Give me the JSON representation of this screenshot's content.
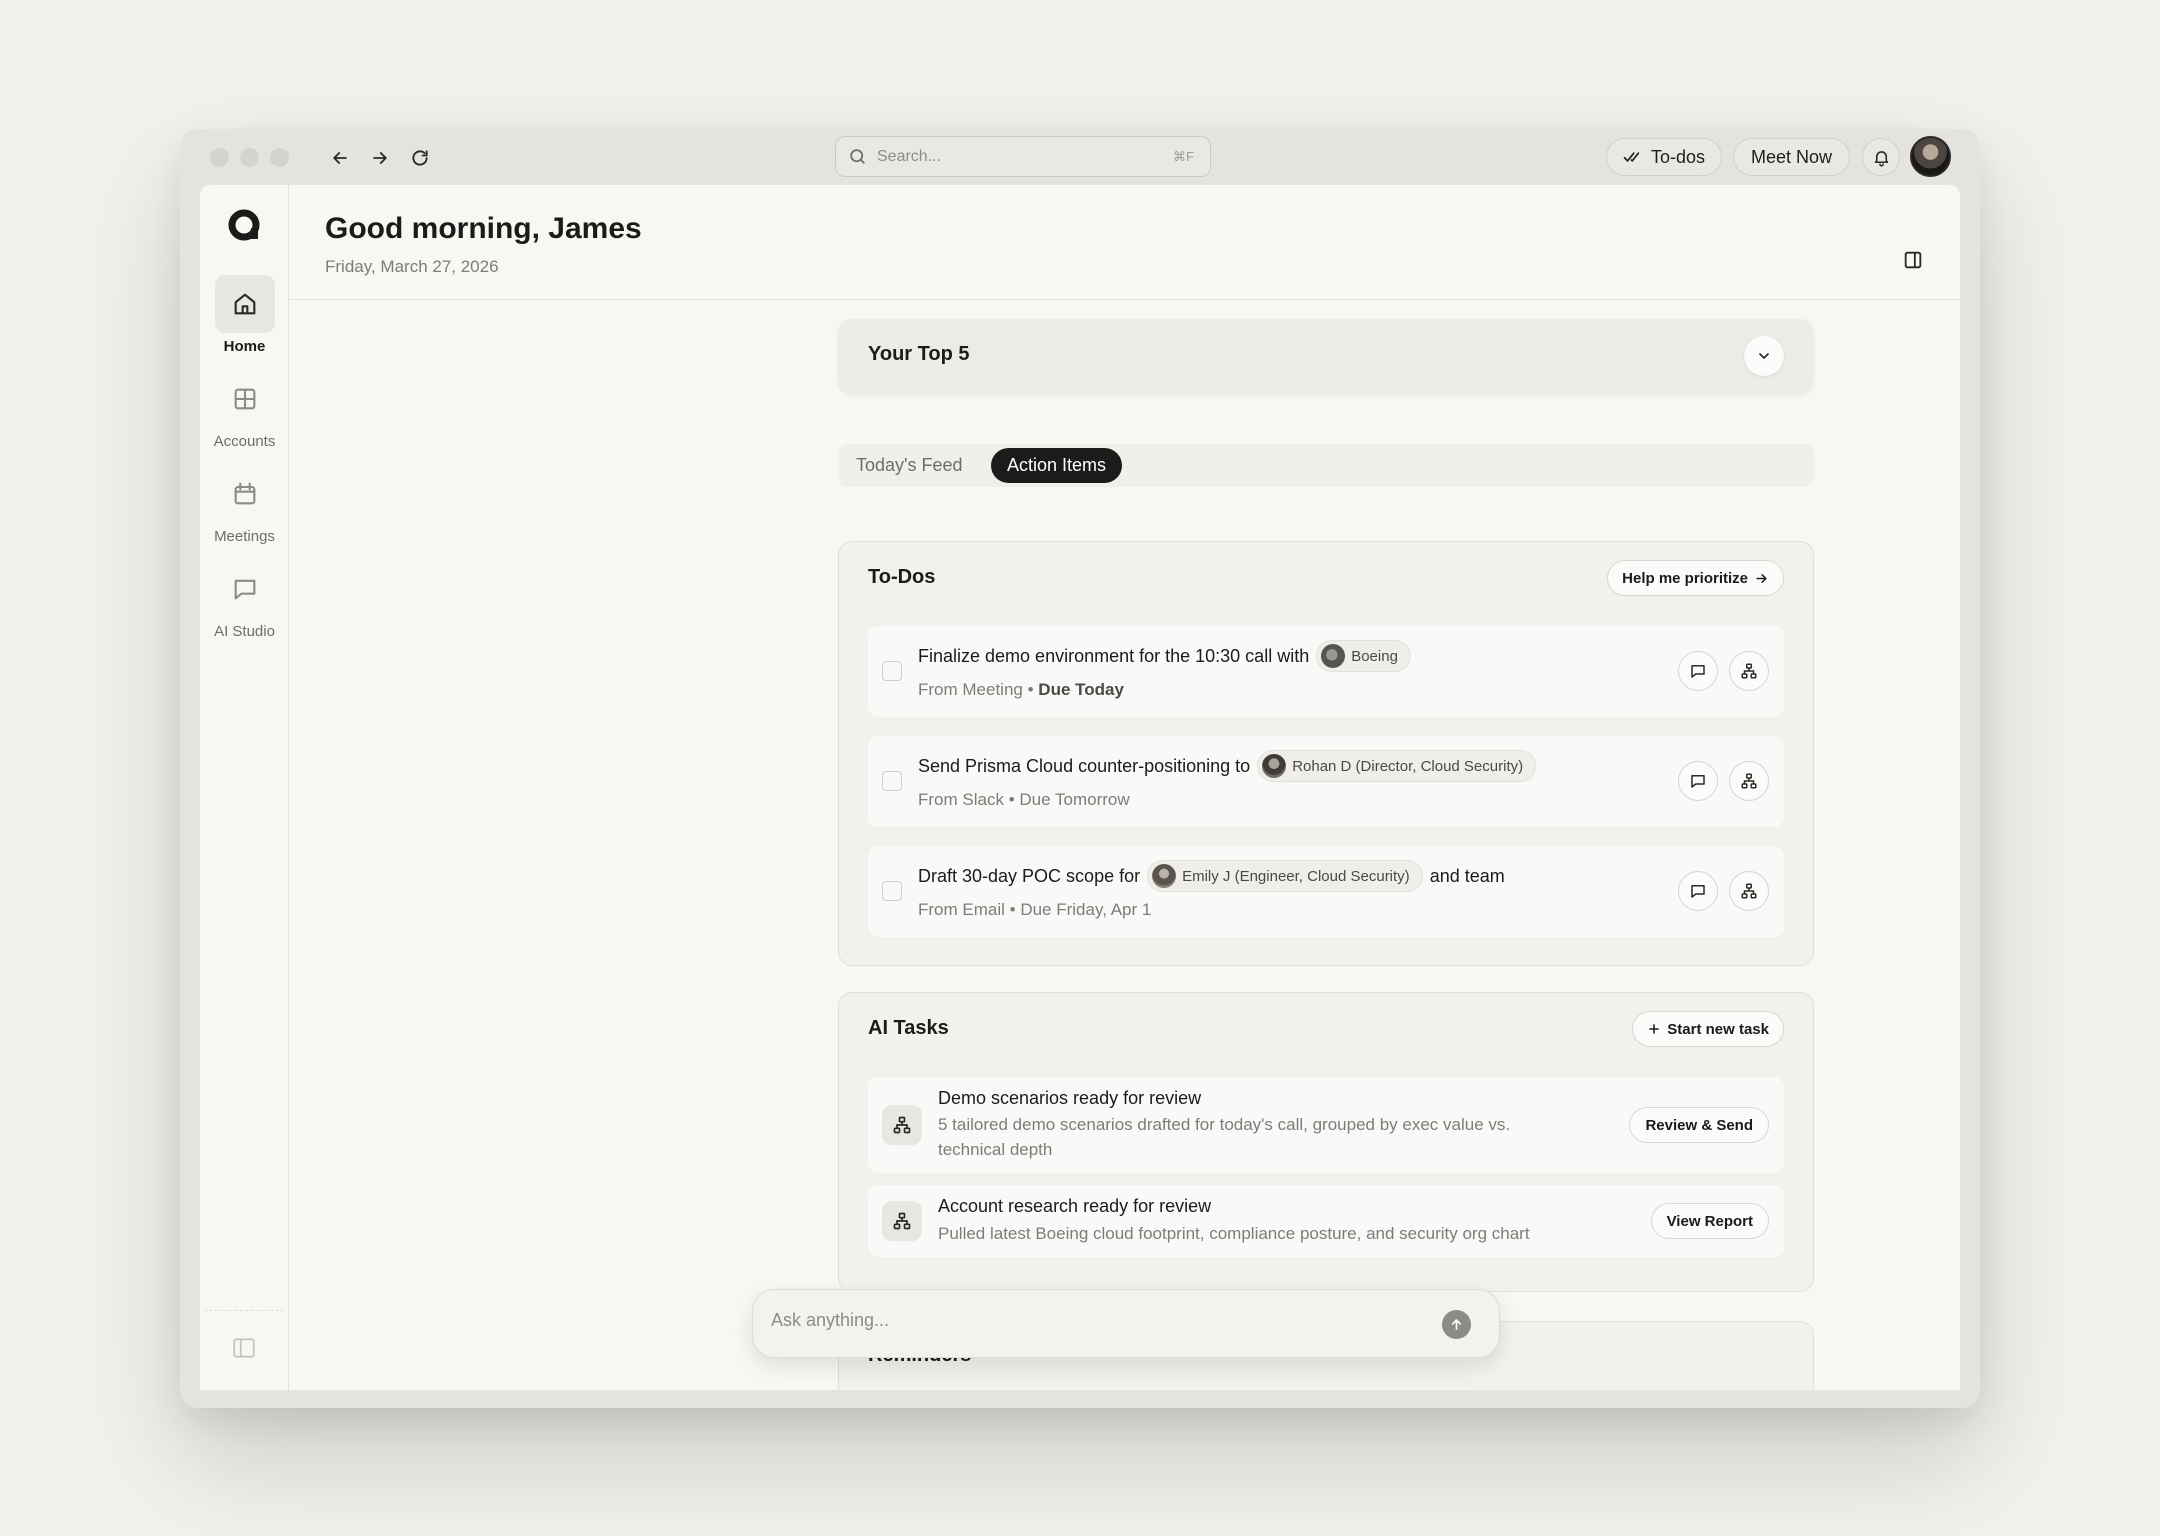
{
  "topbar": {
    "search_placeholder": "Search...",
    "search_shortcut": "⌘F",
    "todos_label": "To-dos",
    "meet_now_label": "Meet Now"
  },
  "sidebar": {
    "items": [
      {
        "label": "Home",
        "icon": "home-icon"
      },
      {
        "label": "Accounts",
        "icon": "grid-icon"
      },
      {
        "label": "Meetings",
        "icon": "calendar-icon"
      },
      {
        "label": "AI Studio",
        "icon": "chat-icon"
      }
    ]
  },
  "header": {
    "greeting": "Good morning, James",
    "date": "Friday, March 27, 2026"
  },
  "top5": {
    "title": "Your Top 5"
  },
  "tabs": [
    {
      "label": "Today's Feed",
      "active": false
    },
    {
      "label": "Action Items",
      "active": true
    }
  ],
  "todos": {
    "title": "To-Dos",
    "action_label": "Help me prioritize",
    "items": [
      {
        "text": "Finalize demo environment for the 10:30 call with",
        "chip": "Boeing",
        "suffix": "",
        "source": "From Meeting",
        "due": "Due Today",
        "due_emphasis": true
      },
      {
        "text": "Send Prisma Cloud counter-positioning to",
        "chip": "Rohan D (Director, Cloud Security)",
        "suffix": "",
        "source": "From Slack",
        "due": "Due Tomorrow",
        "due_emphasis": false
      },
      {
        "text": "Draft 30-day POC scope for",
        "chip": "Emily J (Engineer, Cloud Security)",
        "suffix": "and team",
        "source": "From Email",
        "due": "Due Friday, Apr 1",
        "due_emphasis": false
      }
    ]
  },
  "ai_tasks": {
    "title": "AI Tasks",
    "action_label": "Start new task",
    "items": [
      {
        "title": "Demo scenarios ready for review",
        "desc": "5 tailored demo scenarios drafted for today's call, grouped by exec value vs. technical depth",
        "button": "Review & Send"
      },
      {
        "title": "Account research ready for review",
        "desc": "Pulled latest Boeing cloud footprint, compliance posture, and security org chart",
        "button": "View Report"
      }
    ]
  },
  "reminders": {
    "title": "Reminders"
  },
  "ask": {
    "placeholder": "Ask anything..."
  },
  "meta_separator": "•"
}
